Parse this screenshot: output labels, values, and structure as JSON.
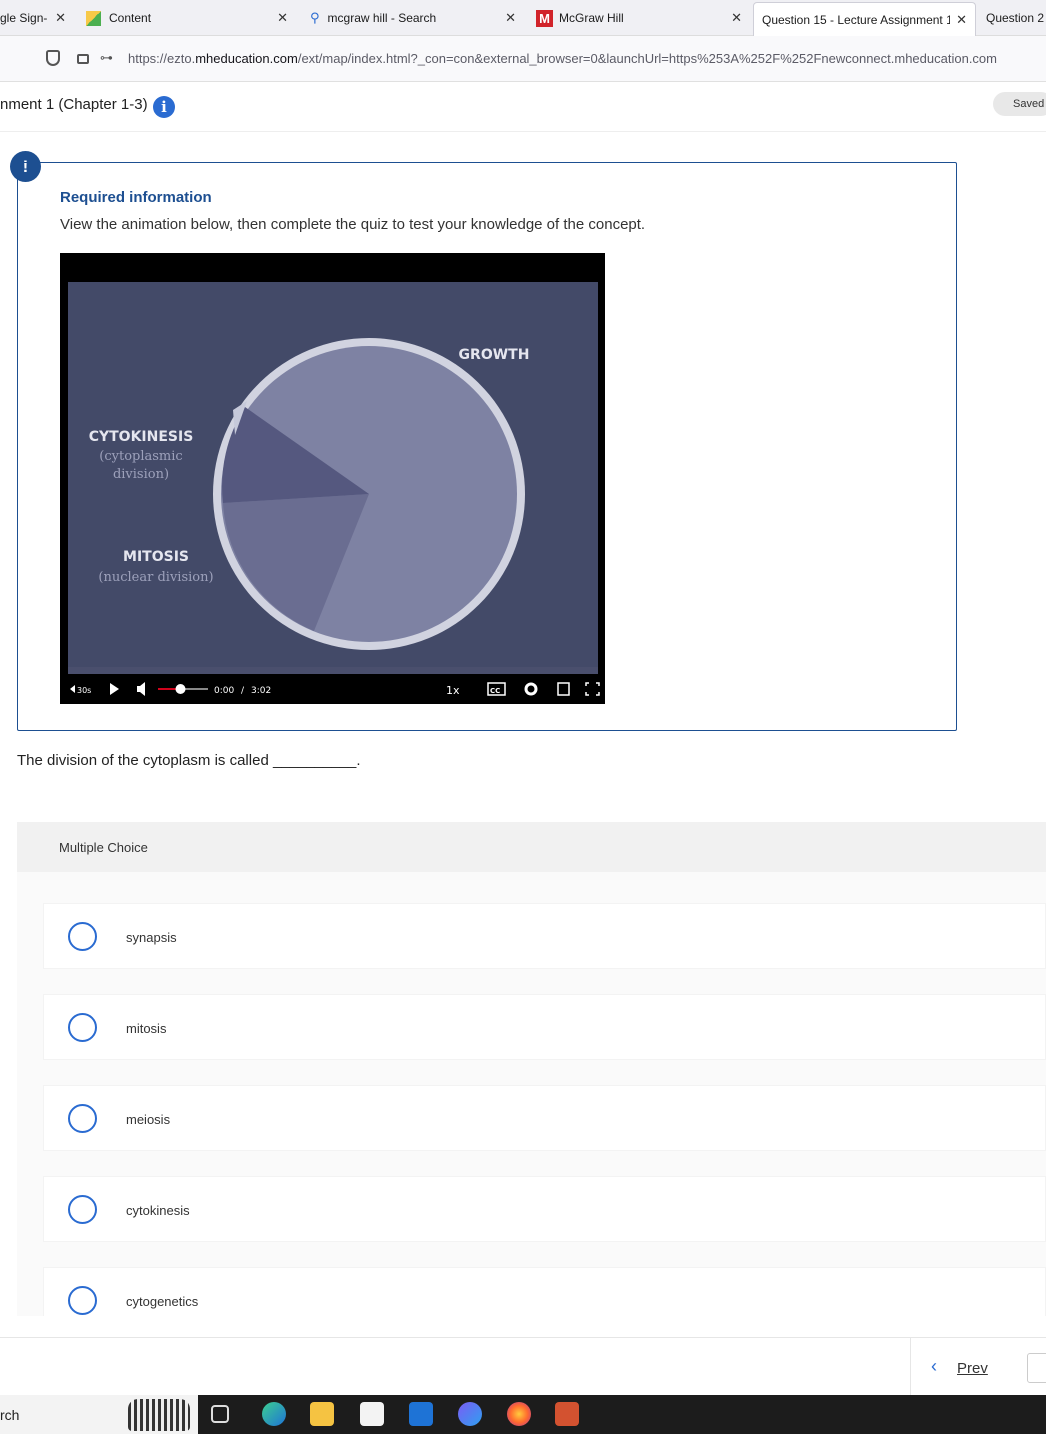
{
  "browser": {
    "tabs": [
      {
        "label": "gle Sign-",
        "has_close": true
      },
      {
        "label": "Content",
        "has_close": true
      },
      {
        "label": "mcgraw hill - Search",
        "has_close": true
      },
      {
        "label": "McGraw Hill",
        "has_close": true
      },
      {
        "label": "Question 15 - Lecture Assignment 1",
        "has_close": true,
        "active": true
      },
      {
        "label": "Question 2",
        "has_close": false
      }
    ],
    "url_prefix": "https://ezto.",
    "url_domain": "mheducation.com",
    "url_path": "/ext/map/index.html?_con=con&external_browser=0&launchUrl=https%253A%252F%252Fnewconnect.mheducation.com"
  },
  "header": {
    "assignment_title": "nment 1 (Chapter 1-3)",
    "saved_label": "Saved"
  },
  "required_info": {
    "alert_symbol": "!",
    "title": "Required information",
    "description": "View the animation below, then complete the quiz to test your knowledge of the concept."
  },
  "video": {
    "labels": {
      "growth": "GROWTH",
      "cytokinesis": "CYTOKINESIS",
      "cytokinesis_sub1": "(cytoplasmic",
      "cytokinesis_sub2": "division)",
      "mitosis": "MITOSIS",
      "mitosis_sub": "(nuclear division)"
    },
    "controls": {
      "rewind_label": "30s",
      "current_time": "0:00",
      "separator": "/",
      "duration": "3:02",
      "speed": "1x",
      "cc": "CC",
      "progress_fraction": 0,
      "volume_fraction": 0.45
    }
  },
  "question": {
    "text": "The division of the cytoplasm is called __________."
  },
  "multiple_choice": {
    "header": "Multiple Choice",
    "options": [
      "synapsis",
      "mitosis",
      "meiosis",
      "cytokinesis",
      "cytogenetics"
    ]
  },
  "footer": {
    "prev_label": "Prev"
  },
  "taskbar": {
    "search_text": "rch"
  }
}
